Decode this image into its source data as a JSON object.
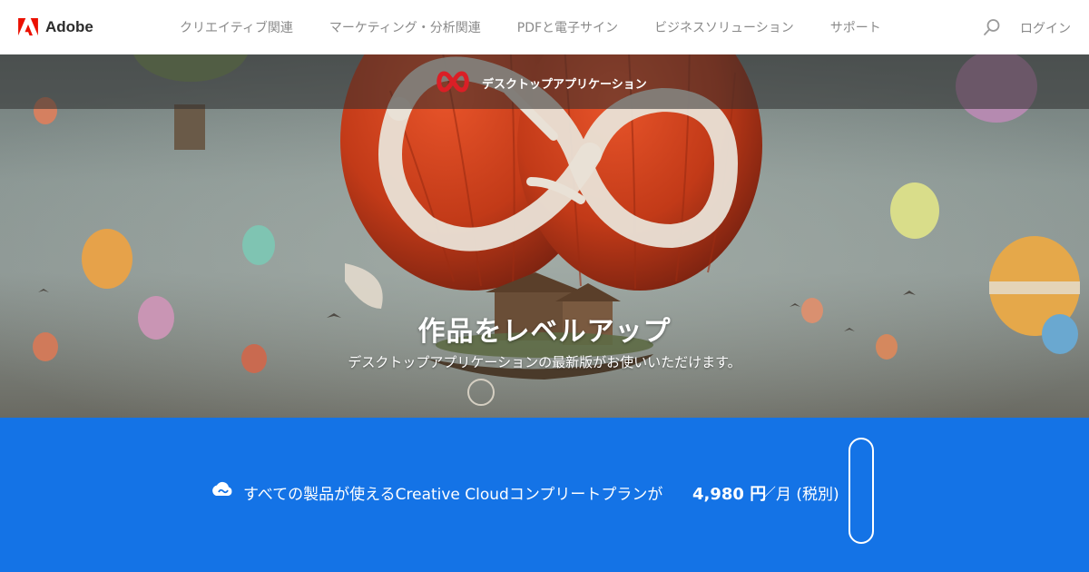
{
  "brand": {
    "name": "Adobe",
    "color": "#eb1000"
  },
  "nav": {
    "items": [
      {
        "label": "クリエイティブ関連"
      },
      {
        "label": "マーケティング・分析関連"
      },
      {
        "label": "PDFと電子サイン"
      },
      {
        "label": "ビジネスソリューション"
      },
      {
        "label": "サポート"
      }
    ],
    "search_icon": "search-icon",
    "login_label": "ログイン"
  },
  "hero": {
    "section_label": "デスクトップアプリケーション",
    "title": "作品をレベルアップ",
    "subtitle": "デスクトップアプリケーションの最新版がお使いいただけます。"
  },
  "promo": {
    "icon": "creative-cloud-icon",
    "text": "すべての製品が使えるCreative Cloudコンプリートプランが",
    "price": "4,980 円",
    "suffix": "／月 (税別)",
    "background": "#1473e6"
  }
}
